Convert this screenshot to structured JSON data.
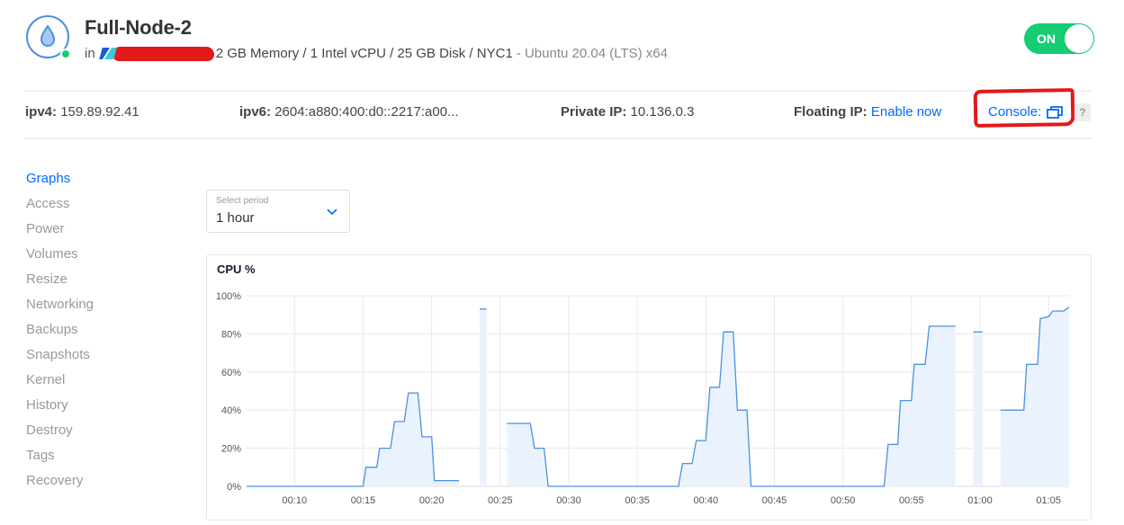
{
  "droplet": {
    "name": "Full-Node-2",
    "icon": "droplet-icon",
    "status": "active",
    "in_label": "in",
    "project_icon": "project-icon",
    "specs": "2 GB Memory / 1 Intel vCPU / 25 GB Disk / NYC1",
    "os": "- Ubuntu 20.04 (LTS) x64",
    "power_label": "ON",
    "power_on": true
  },
  "network": {
    "ipv4_label": "ipv4:",
    "ipv4": "159.89.92.41",
    "ipv6_label": "ipv6:",
    "ipv6": "2604:a880:400:d0::2217:a00...",
    "private_ip_label": "Private IP:",
    "private_ip": "10.136.0.3",
    "floating_ip_label": "Floating IP:",
    "floating_ip_link": "Enable now",
    "console_label": "Console:",
    "console_icon": "external-window-icon",
    "help_label": "?"
  },
  "sidebar": {
    "items": [
      {
        "label": "Graphs",
        "active": true
      },
      {
        "label": "Access"
      },
      {
        "label": "Power"
      },
      {
        "label": "Volumes"
      },
      {
        "label": "Resize"
      },
      {
        "label": "Networking"
      },
      {
        "label": "Backups"
      },
      {
        "label": "Snapshots"
      },
      {
        "label": "Kernel"
      },
      {
        "label": "History"
      },
      {
        "label": "Destroy"
      },
      {
        "label": "Tags"
      },
      {
        "label": "Recovery"
      }
    ]
  },
  "period_select": {
    "caption": "Select period",
    "value": "1 hour"
  },
  "colors": {
    "accent": "#0069ff",
    "status_green": "#15cd72",
    "line": "#4a90e2",
    "fill": "#eaf3fd",
    "annotation_red": "#e11a1a"
  },
  "chart_data": {
    "type": "area",
    "title": "CPU %",
    "xlabel": "",
    "ylabel": "",
    "ylim": [
      0,
      100
    ],
    "y_ticks": [
      "0%",
      "20%",
      "40%",
      "60%",
      "80%",
      "100%"
    ],
    "x_ticks": [
      "00:10",
      "00:15",
      "00:20",
      "00:25",
      "00:30",
      "00:35",
      "00:40",
      "00:45",
      "00:50",
      "00:55",
      "01:00",
      "01:05"
    ],
    "x_range_minutes": [
      6.5,
      66.5
    ],
    "grid": true,
    "legend": "none",
    "series": [
      {
        "name": "CPU %",
        "segments": [
          [
            [
              6.5,
              0
            ],
            [
              15.0,
              0
            ],
            [
              15.2,
              10
            ],
            [
              16.0,
              10
            ],
            [
              16.2,
              20
            ],
            [
              17.0,
              20
            ],
            [
              17.3,
              34
            ],
            [
              18.0,
              34
            ],
            [
              18.3,
              49
            ],
            [
              19.0,
              49
            ],
            [
              19.3,
              26
            ],
            [
              20.0,
              26
            ],
            [
              20.2,
              3
            ],
            [
              22.0,
              3
            ]
          ],
          [
            [
              23.5,
              93
            ],
            [
              24.0,
              93
            ]
          ],
          [
            [
              25.5,
              33
            ],
            [
              27.2,
              33
            ],
            [
              27.5,
              20
            ],
            [
              28.2,
              20
            ],
            [
              28.5,
              0
            ],
            [
              38.0,
              0
            ],
            [
              38.3,
              12
            ],
            [
              39.0,
              12
            ],
            [
              39.3,
              24
            ],
            [
              40.0,
              24
            ],
            [
              40.3,
              52
            ],
            [
              41.0,
              52
            ],
            [
              41.3,
              81
            ],
            [
              42.0,
              81
            ],
            [
              42.3,
              40
            ],
            [
              43.0,
              40
            ],
            [
              43.3,
              0
            ],
            [
              53.0,
              0
            ],
            [
              53.3,
              22
            ],
            [
              54.0,
              22
            ],
            [
              54.2,
              45
            ],
            [
              55.0,
              45
            ],
            [
              55.2,
              64
            ],
            [
              56.0,
              64
            ],
            [
              56.3,
              84
            ],
            [
              58.2,
              84
            ]
          ],
          [
            [
              59.5,
              81
            ],
            [
              60.2,
              81
            ]
          ],
          [
            [
              61.5,
              40
            ],
            [
              63.2,
              40
            ],
            [
              63.4,
              64
            ],
            [
              64.2,
              64
            ],
            [
              64.4,
              88
            ],
            [
              65.0,
              89
            ],
            [
              65.3,
              92
            ],
            [
              66.1,
              92
            ],
            [
              66.5,
              94
            ]
          ]
        ]
      }
    ]
  }
}
